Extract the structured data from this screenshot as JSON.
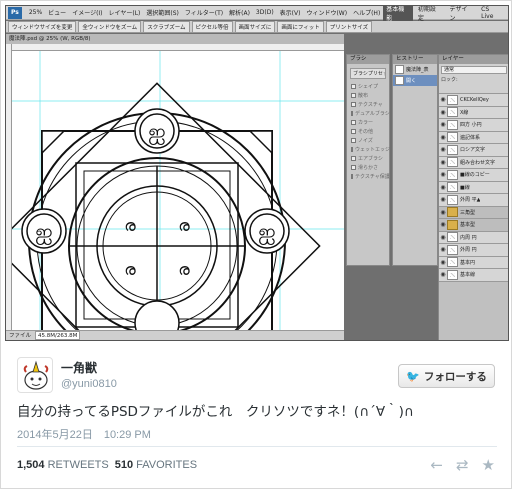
{
  "menubar": {
    "logo": "Ps",
    "zoom": "25%",
    "items": [
      "ビュー",
      "イメージ(I)",
      "レイヤー(L)",
      "選択範囲(S)",
      "フィルター(T)",
      "解析(A)",
      "3D(D)",
      "表示(V)",
      "ウィンドウ(W)",
      "ヘルプ(H)"
    ],
    "workspaces": [
      "基本機能",
      "初期設定",
      "デザイン"
    ],
    "cs_live": "CS Live"
  },
  "optbar": {
    "options": [
      "ウィンドウサイズを変更",
      "全ウィンドウをズーム",
      "スクラブズーム",
      "ピクセル等倍",
      "画面サイズに",
      "画面にフィット",
      "プリントサイズ"
    ]
  },
  "document": {
    "tab_title": "魔法陣.psd @ 25% (W, RGB/8)",
    "status_label": "ファイル",
    "status_value": "45.8M/263.8M"
  },
  "brush_panel": {
    "title": "ブラシ",
    "preset_button": "ブラシプリセット",
    "options": [
      "シェイプ",
      "散布",
      "テクスチャ",
      "デュアルブラシ",
      "カラー",
      "その他",
      "ノイズ",
      "ウェットエッジ",
      "エアブラシ",
      "滑らかさ",
      "テクスチャ保護"
    ]
  },
  "history_panel": {
    "title": "ヒストリー",
    "items": [
      "魔法陣_表",
      "開く"
    ]
  },
  "layers_panel": {
    "title": "レイヤー",
    "blend_mode": "通常",
    "lock_label": "ロック:",
    "layers": [
      {
        "name": "CKCKellQey",
        "group": false
      },
      {
        "name": "X線",
        "group": false
      },
      {
        "name": "四方 小円",
        "group": false
      },
      {
        "name": "遍記体系",
        "group": false
      },
      {
        "name": "ロシア文字",
        "group": false
      },
      {
        "name": "組み合わせ文字",
        "group": false
      },
      {
        "name": "■線のコピー",
        "group": false
      },
      {
        "name": "■線",
        "group": false
      },
      {
        "name": "外周 平▲",
        "group": false
      },
      {
        "name": "三角型",
        "group": true
      },
      {
        "name": "基本型",
        "group": true
      },
      {
        "name": "内周 円",
        "group": false
      },
      {
        "name": "外周 円",
        "group": false
      },
      {
        "name": "基本円",
        "group": false
      },
      {
        "name": "基本線",
        "group": false
      }
    ]
  },
  "tweet": {
    "display_name": "一角獣",
    "handle": "@yuni0810",
    "follow_label": "フォローする",
    "text": "自分の持ってるPSDファイルがこれ　クリソツですネ！(∩´∀｀)∩",
    "timestamp": "2014年5月22日　10:29 PM",
    "retweets_count": "1,504",
    "retweets_label": "RETWEETS",
    "favorites_count": "510",
    "favorites_label": "FAVORITES"
  },
  "colors": {
    "twitter_blue": "#55acee",
    "text_dark": "#292f33",
    "text_muted": "#8899a6",
    "ps_panel": "#c7c7c7",
    "ps_selection": "#6d8fbf"
  },
  "icons": [
    "photoshop-logo-icon",
    "eye-icon",
    "folder-icon",
    "twitter-bird-icon",
    "reply-icon",
    "retweet-icon",
    "favorite-star-icon"
  ]
}
